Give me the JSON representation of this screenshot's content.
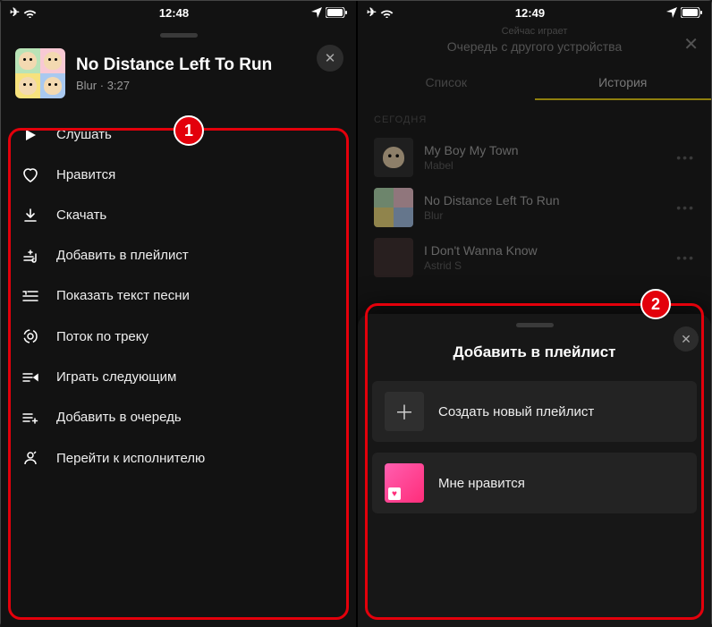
{
  "left": {
    "status": {
      "time": "12:48"
    },
    "track": {
      "title": "No Distance Left To Run",
      "artist": "Blur",
      "duration": "3:27"
    },
    "menu": [
      {
        "label": "Слушать",
        "icon": "play"
      },
      {
        "label": "Нравится",
        "icon": "heart"
      },
      {
        "label": "Скачать",
        "icon": "download"
      },
      {
        "label": "Добавить в плейлист",
        "icon": "playlist-add"
      },
      {
        "label": "Показать текст песни",
        "icon": "lyrics"
      },
      {
        "label": "Поток по треку",
        "icon": "radio"
      },
      {
        "label": "Играть следующим",
        "icon": "play-next"
      },
      {
        "label": "Добавить в очередь",
        "icon": "queue-add"
      },
      {
        "label": "Перейти к исполнителю",
        "icon": "artist"
      }
    ],
    "badge": "1"
  },
  "right": {
    "status": {
      "time": "12:49"
    },
    "nowplaying": {
      "sub": "Сейчас играет",
      "title": "Очередь с другого устройства"
    },
    "tabs": {
      "list": "Список",
      "history": "История",
      "active": "history"
    },
    "section": "СЕГОДНЯ",
    "queue": [
      {
        "title": "My Boy My Town",
        "artist": "Mabel"
      },
      {
        "title": "No Distance Left To Run",
        "artist": "Blur"
      },
      {
        "title": "I Don't Wanna Know",
        "artist": "Astrid S"
      }
    ],
    "sheet": {
      "title": "Добавить в плейлист",
      "create": "Создать новый плейлист",
      "liked": "Мне нравится"
    },
    "badge": "2"
  }
}
